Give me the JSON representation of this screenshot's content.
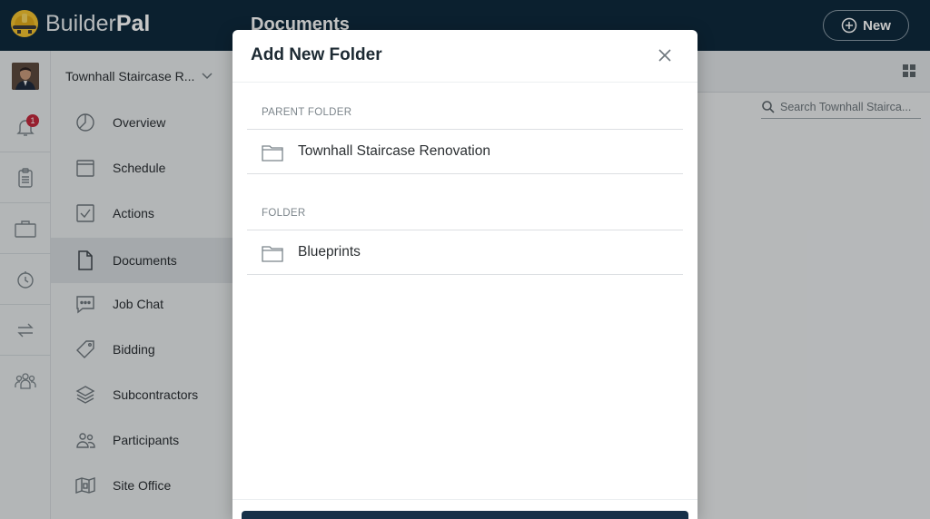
{
  "app": {
    "brand_light": "Builder",
    "brand_bold": "Pal"
  },
  "header": {
    "title": "Documents",
    "new_button_label": "New"
  },
  "rail": {
    "notification_count": "1"
  },
  "project": {
    "name": "Townhall Staircase R..."
  },
  "nav": [
    {
      "label": "Overview",
      "icon": "pie-chart-icon"
    },
    {
      "label": "Schedule",
      "icon": "calendar-icon"
    },
    {
      "label": "Actions",
      "icon": "checkbox-icon"
    },
    {
      "label": "Documents",
      "icon": "document-icon",
      "active": true
    },
    {
      "label": "Job Chat",
      "icon": "chat-icon"
    },
    {
      "label": "Bidding",
      "icon": "tag-icon"
    },
    {
      "label": "Subcontractors",
      "icon": "layers-icon"
    },
    {
      "label": "Participants",
      "icon": "people-icon"
    },
    {
      "label": "Site Office",
      "icon": "site-office-icon"
    }
  ],
  "search": {
    "placeholder": "Search Townhall Stairca..."
  },
  "modal": {
    "title": "Add New Folder",
    "parent_label": "PARENT FOLDER",
    "parent_value": "Townhall Staircase Renovation",
    "folder_label": "FOLDER",
    "folder_value": "Blueprints"
  },
  "colors": {
    "topbar": "#0f2a3d",
    "accent_badge": "#c0283b",
    "button_dark": "#163048"
  }
}
